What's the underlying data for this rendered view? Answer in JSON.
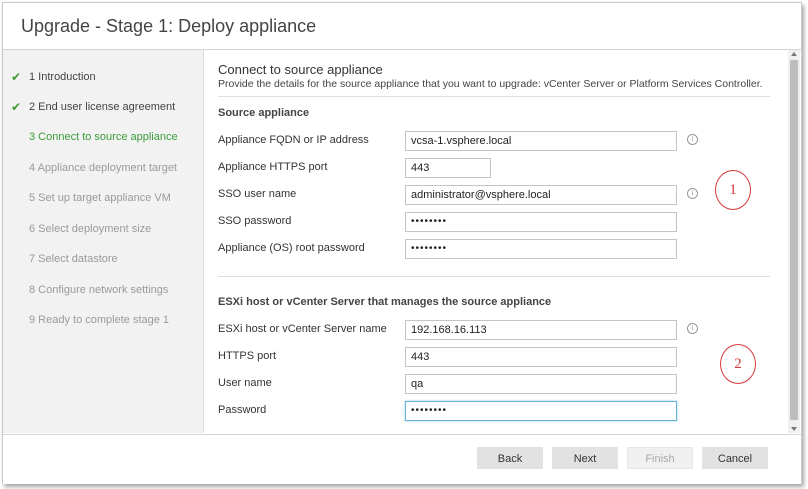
{
  "window": {
    "title": "Upgrade - Stage 1: Deploy appliance"
  },
  "sidebar": {
    "steps": [
      {
        "label": "1 Introduction",
        "state": "done"
      },
      {
        "label": "2 End user license agreement",
        "state": "done"
      },
      {
        "label": "3 Connect to source appliance",
        "state": "current"
      },
      {
        "label": "4 Appliance deployment target",
        "state": "pending"
      },
      {
        "label": "5 Set up target appliance VM",
        "state": "pending"
      },
      {
        "label": "6 Select deployment size",
        "state": "pending"
      },
      {
        "label": "7 Select datastore",
        "state": "pending"
      },
      {
        "label": "8 Configure network settings",
        "state": "pending"
      },
      {
        "label": "9 Ready to complete stage 1",
        "state": "pending"
      }
    ],
    "check_glyph": "✔"
  },
  "main": {
    "heading": "Connect to source appliance",
    "subheading": "Provide the details for the source appliance that you want to upgrade: vCenter Server or Platform Services Controller.",
    "source_section": {
      "title": "Source appliance",
      "fields": [
        {
          "label": "Appliance FQDN or IP address",
          "value": "vcsa-1.vsphere.local"
        },
        {
          "label": "Appliance HTTPS port",
          "value": "443"
        },
        {
          "label": "SSO user name",
          "value": "administrator@vsphere.local"
        },
        {
          "label": "SSO password",
          "value": "••••••••"
        },
        {
          "label": "Appliance (OS) root password",
          "value": "••••••••"
        }
      ]
    },
    "esxi_section": {
      "title": "ESXi host or vCenter Server that manages the source appliance",
      "fields": [
        {
          "label": "ESXi host or vCenter Server name",
          "value": "192.168.16.113"
        },
        {
          "label": "HTTPS port",
          "value": "443"
        },
        {
          "label": "User name",
          "value": "qa"
        },
        {
          "label": "Password",
          "value": "••••••••"
        }
      ]
    },
    "info_glyph": "i",
    "annotations": [
      "1",
      "2"
    ]
  },
  "footer": {
    "back_label": "Back",
    "next_label": "Next",
    "finish_label": "Finish",
    "cancel_label": "Cancel"
  },
  "colors": {
    "check": "#3c9a2e",
    "current_step": "#3a9d3a",
    "annotation": "#d63a3a",
    "focus_border": "#6bb3d9"
  }
}
